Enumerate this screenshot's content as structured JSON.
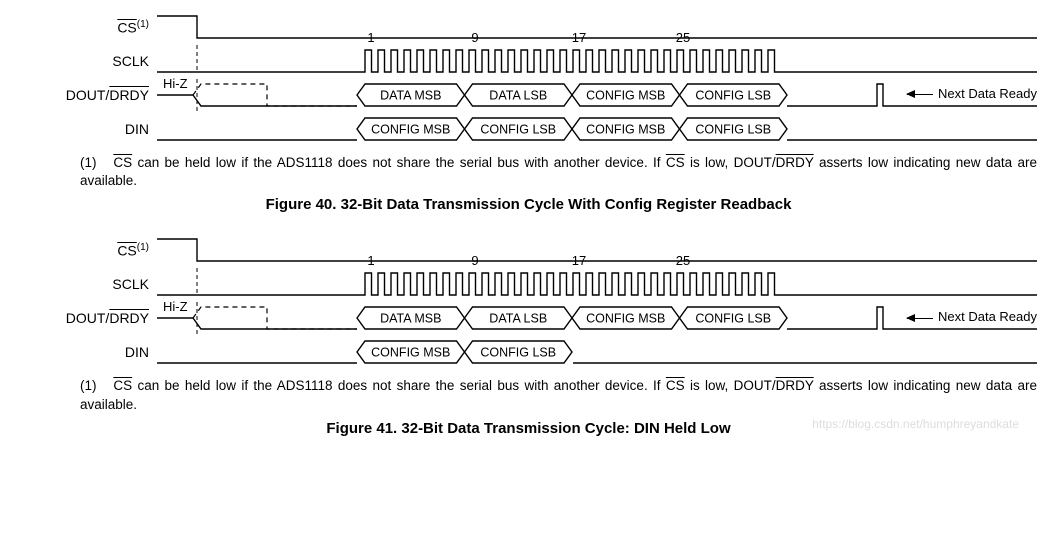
{
  "chart_data": [
    {
      "type": "timing-diagram",
      "figure": "40",
      "title": "32-Bit Data Transmission Cycle With Config Register Readback",
      "clock_edges": [
        1,
        9,
        17,
        25
      ],
      "signals": [
        {
          "name": "CS",
          "overline": true,
          "superscript": "(1)",
          "trace": "high-then-low"
        },
        {
          "name": "SCLK",
          "trace": "32-pulse-burst"
        },
        {
          "name": "DOUT/DRDY",
          "overline_part": "DRDY",
          "initial": "Hi-Z",
          "bus": [
            "DATA MSB",
            "DATA LSB",
            "CONFIG MSB",
            "CONFIG LSB"
          ],
          "tail_event": "Next Data Ready"
        },
        {
          "name": "DIN",
          "bus": [
            "CONFIG MSB",
            "CONFIG LSB",
            "CONFIG MSB",
            "CONFIG LSB"
          ]
        }
      ]
    },
    {
      "type": "timing-diagram",
      "figure": "41",
      "title": "32-Bit Data Transmission Cycle: DIN Held Low",
      "clock_edges": [
        1,
        9,
        17,
        25
      ],
      "signals": [
        {
          "name": "CS",
          "overline": true,
          "superscript": "(1)",
          "trace": "high-then-low"
        },
        {
          "name": "SCLK",
          "trace": "32-pulse-burst"
        },
        {
          "name": "DOUT/DRDY",
          "overline_part": "DRDY",
          "initial": "Hi-Z",
          "bus": [
            "DATA MSB",
            "DATA LSB",
            "CONFIG MSB",
            "CONFIG LSB"
          ],
          "tail_event": "Next Data Ready"
        },
        {
          "name": "DIN",
          "bus": [
            "CONFIG MSB",
            "CONFIG LSB"
          ],
          "tail": "low"
        }
      ]
    }
  ],
  "labels": {
    "cs": "CS",
    "cs_sup": "(1)",
    "sclk": "SCLK",
    "dout": "DOUT/",
    "drdy": "DRDY",
    "din": "DIN",
    "hiz": "Hi-Z",
    "next_ready": "Next Data Ready"
  },
  "ticks": {
    "t1": "1",
    "t9": "9",
    "t17": "17",
    "t25": "25"
  },
  "bus40_dout": {
    "a": "DATA MSB",
    "b": "DATA LSB",
    "c": "CONFIG MSB",
    "d": "CONFIG LSB"
  },
  "bus40_din": {
    "a": "CONFIG MSB",
    "b": "CONFIG LSB",
    "c": "CONFIG MSB",
    "d": "CONFIG LSB"
  },
  "bus41_dout": {
    "a": "DATA MSB",
    "b": "DATA LSB",
    "c": "CONFIG MSB",
    "d": "CONFIG LSB"
  },
  "bus41_din": {
    "a": "CONFIG MSB",
    "b": "CONFIG LSB"
  },
  "footnote": {
    "num": "(1)",
    "pre": " can be held low if the ADS1118 does not share the serial bus with another device. If ",
    "post": " is low, DOUT/",
    "tail": " asserts low indicating new data are available."
  },
  "captions": {
    "fig40": "Figure 40.  32-Bit Data Transmission Cycle With Config Register Readback",
    "fig41": "Figure 41.  32-Bit Data Transmission Cycle: DIN Held Low"
  },
  "watermark": "https://blog.csdn.net/humphreyandkate"
}
